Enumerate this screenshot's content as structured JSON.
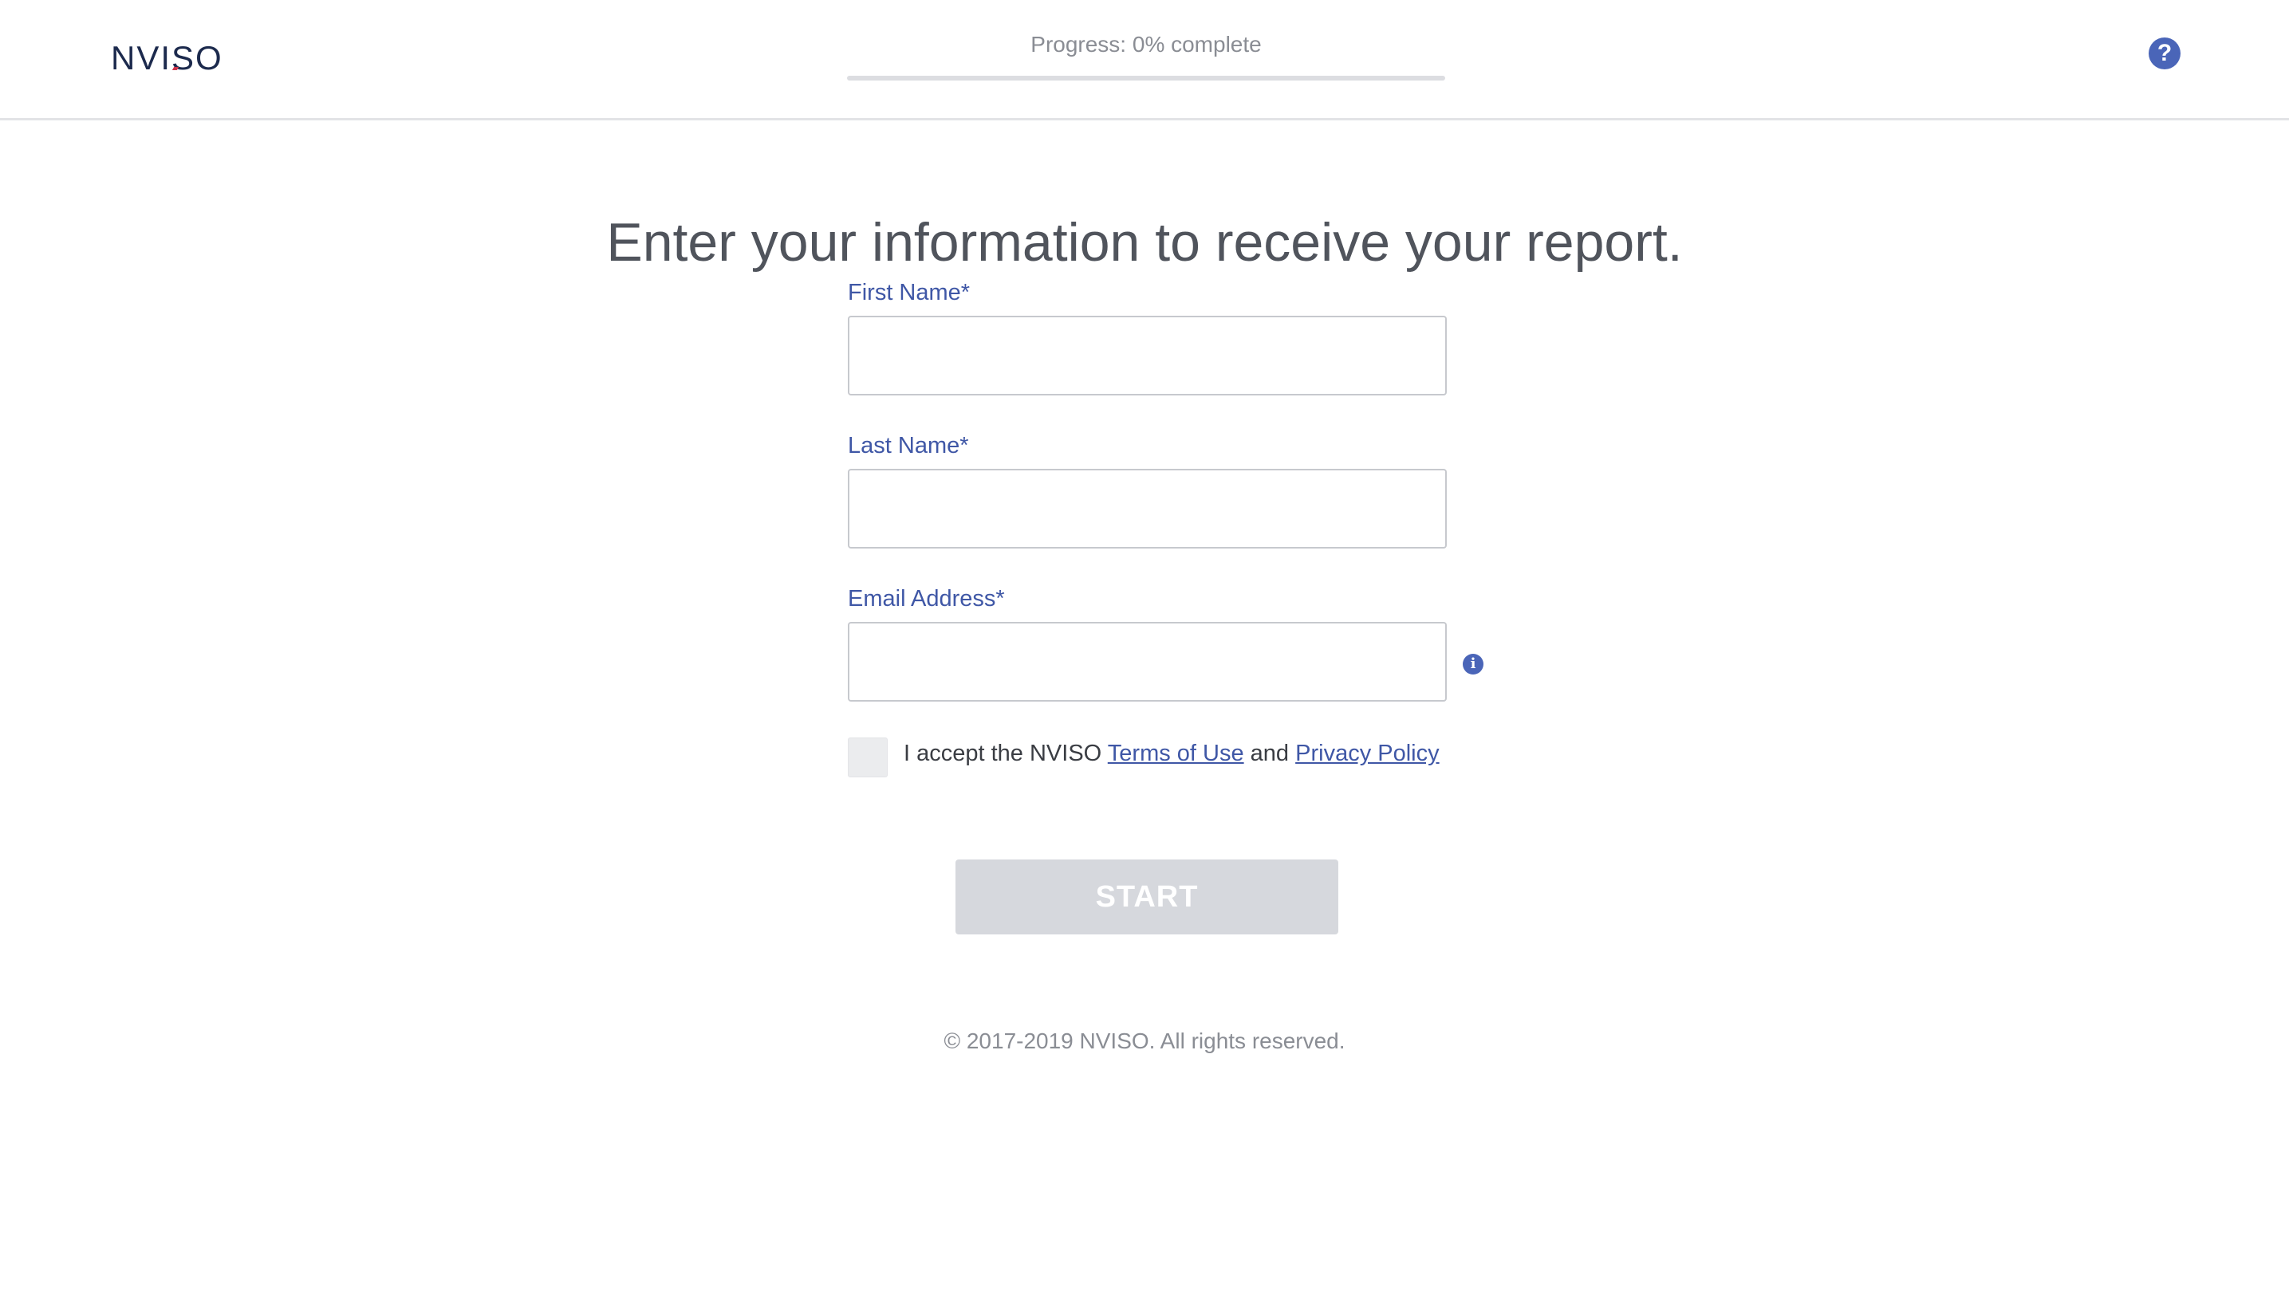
{
  "header": {
    "logo_text": "NVISO",
    "progress_label": "Progress: 0% complete",
    "progress_value": 0,
    "help_icon": "question-circle-icon"
  },
  "main": {
    "title": "Enter your information to receive your report.",
    "fields": [
      {
        "label": "First Name*",
        "value": "",
        "placeholder": ""
      },
      {
        "label": "Last Name*",
        "value": "",
        "placeholder": ""
      },
      {
        "label": "Email Address*",
        "value": "",
        "placeholder": ""
      }
    ],
    "email_info_icon": "info-circle-icon",
    "terms": {
      "prefix": "I accept the NVISO",
      "terms_link": "Terms of Use",
      "conjunction": "and",
      "privacy_link": "Privacy Policy",
      "checked": false
    },
    "start_button": "START"
  },
  "footer": {
    "copyright": "© 2017-2019 NVISO. All rights reserved."
  },
  "colors": {
    "accent": "#3f57a6",
    "button_disabled": "#d6d8dd",
    "title_text": "#50545c",
    "muted_text": "#8a8d94"
  }
}
